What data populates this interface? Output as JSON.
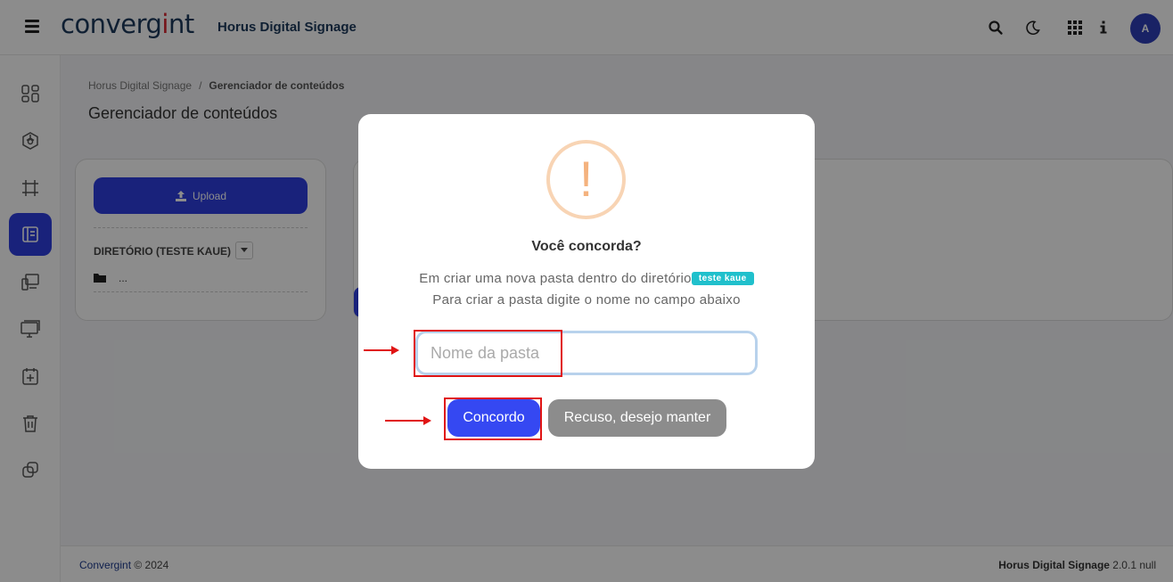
{
  "header": {
    "logo_text_1": "converg",
    "logo_text_2": "i",
    "logo_text_3": "nt",
    "app_title": "Horus Digital Signage",
    "avatar_initial": "A"
  },
  "sidebar": {
    "items": [
      {
        "icon": "dashboard-icon"
      },
      {
        "icon": "cube-icon"
      },
      {
        "icon": "crop-icon"
      },
      {
        "icon": "content-manager-icon",
        "active": true
      },
      {
        "icon": "devices-icon"
      },
      {
        "icon": "monitor-icon"
      },
      {
        "icon": "calendar-add-icon"
      },
      {
        "icon": "trash-icon"
      },
      {
        "icon": "copy-icon"
      }
    ]
  },
  "breadcrumb": {
    "root": "Horus Digital Signage",
    "separator": "/",
    "current": "Gerenciador de conteúdos"
  },
  "main": {
    "page_title": "Gerenciador de conteúdos",
    "upload_label": "Upload",
    "directory_label": "DIRETÓRIO (TESTE KAUE)",
    "folder_item": "..."
  },
  "footer": {
    "brand": "Convergint",
    "copyright": "© 2024",
    "product": "Horus Digital Signage",
    "version": "2.0.1 null"
  },
  "modal": {
    "icon_glyph": "!",
    "title": "Você concorda?",
    "text_line_1": "Em criar uma nova pasta dentro do diretório",
    "folder_tag": "teste kaue",
    "text_line_2": "Para criar a pasta digite o nome no campo abaixo",
    "input_placeholder": "Nome da pasta",
    "input_value": "",
    "confirm_label": "Concordo",
    "cancel_label": "Recuso, desejo manter"
  },
  "colors": {
    "primary": "#2e3fe0",
    "brand_dark": "#1d3a5c",
    "brand_red": "#d8262f",
    "tag": "#20c0cc",
    "warning": "#f4b27e",
    "annotation_red": "#e01414"
  }
}
